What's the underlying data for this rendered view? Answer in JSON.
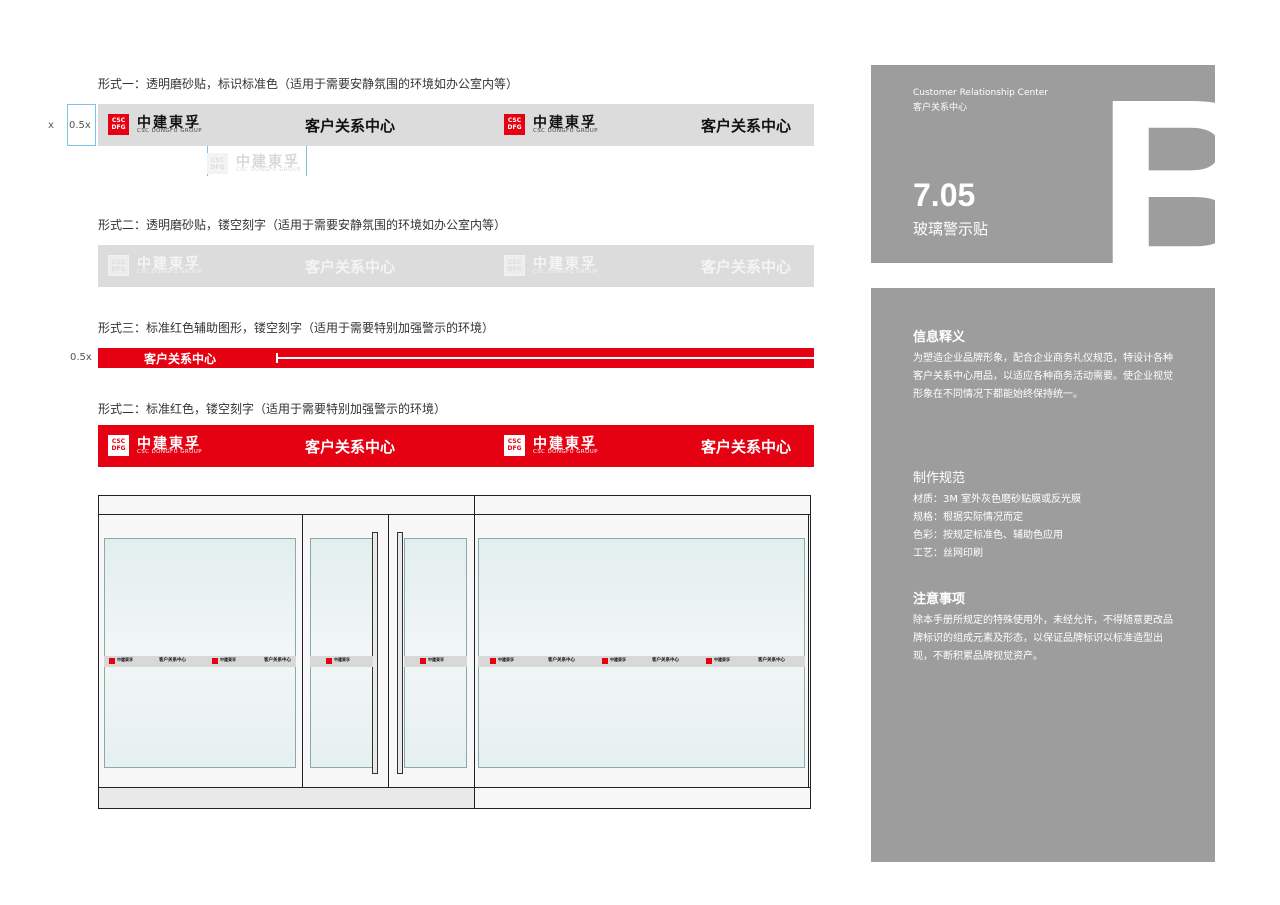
{
  "brand": {
    "seal_text": "CSC DFG",
    "logo_cn": "中建東孚",
    "logo_en": "CSC DONGFU GROUP",
    "center_name": "客户关系中心"
  },
  "forms": [
    {
      "caption": "形式一：透明磨砂贴，标识标准色（适用于需要安静氛围的环境如办公室内等）"
    },
    {
      "caption": "形式二：透明磨砂贴，镂空刻字（适用于需要安静氛围的环境如办公室内等）"
    },
    {
      "caption": "形式三：标准红色辅助图形，镂空刻字（适用于需要特别加强警示的环境）"
    },
    {
      "caption": "形式二：标准红色，镂空刻字（适用于需要特别加强警示的环境）"
    }
  ],
  "measures": {
    "x": "x",
    "half_x": "0.5x"
  },
  "header_panel": {
    "en": "Customer Relationship Center",
    "cn": "客户关系中心",
    "section_number": "7.05",
    "section_title": "玻璃警示贴",
    "big_letter": "B"
  },
  "info": {
    "title": "信息释义",
    "body": "为塑造企业品牌形象，配合企业商务礼仪规范，特设计各种客户关系中心用品，以适应各种商务活动需要。使企业视觉形象在不同情况下都能始终保持统一。"
  },
  "spec": {
    "title": "制作规范",
    "lines": [
      "材质：3M 室外灰色磨砂贴膜或反光膜",
      "规格：根据实际情况而定",
      "色彩：按规定标准色、辅助色应用",
      "工艺：丝网印刷"
    ]
  },
  "notes": {
    "title": "注意事项",
    "body": "除本手册所规定的特殊使用外，未经允许，不得随意更改品牌标识的组成元素及形态，以保证品牌标识以标准造型出现，不断积累品牌视觉资产。"
  },
  "colors": {
    "brand_red": "#e50012",
    "frost_grey": "#dcdcdc",
    "panel_grey": "#9d9d9d"
  }
}
